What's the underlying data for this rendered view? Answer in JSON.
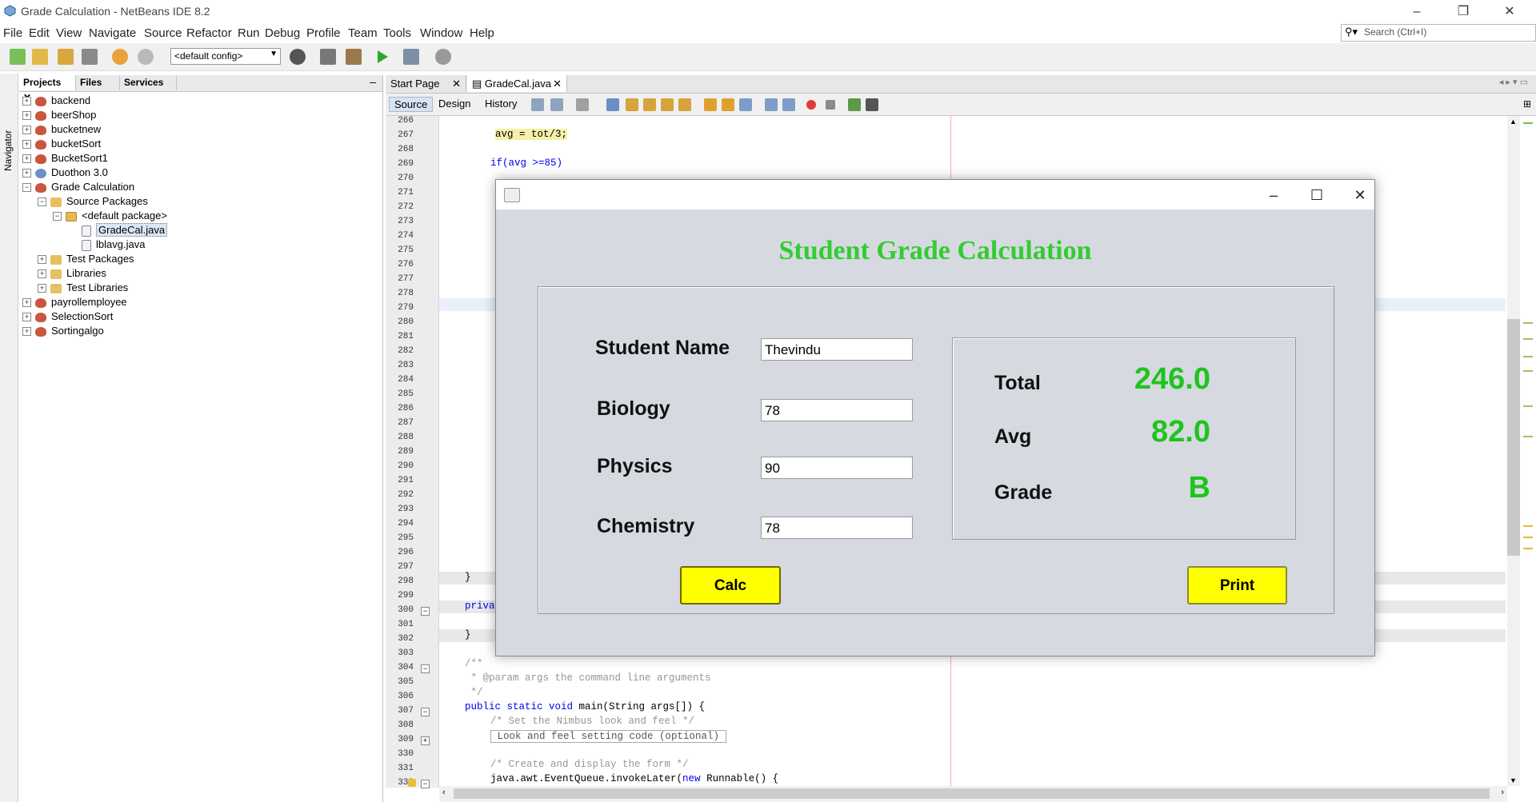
{
  "window": {
    "title": "Grade Calculation - NetBeans IDE 8.2",
    "search_placeholder": "Search (Ctrl+I)"
  },
  "menu": [
    "File",
    "Edit",
    "View",
    "Navigate",
    "Source",
    "Refactor",
    "Run",
    "Debug",
    "Profile",
    "Team",
    "Tools",
    "Window",
    "Help"
  ],
  "toolbar": {
    "config": "<default config>"
  },
  "sidebar": {
    "navigator_label": "Navigator",
    "tabs": [
      "Projects",
      "Files",
      "Services"
    ],
    "tree": [
      {
        "label": "backend",
        "icon": "coffee-icon",
        "expand": "+"
      },
      {
        "label": "beerShop",
        "icon": "coffee-icon",
        "expand": "+"
      },
      {
        "label": "bucketnew",
        "icon": "coffee-icon",
        "expand": "+"
      },
      {
        "label": "bucketSort",
        "icon": "coffee-icon",
        "expand": "+"
      },
      {
        "label": "BucketSort1",
        "icon": "coffee-icon",
        "expand": "+"
      },
      {
        "label": "Duothon 3.0",
        "icon": "globe-icon",
        "expand": "+"
      },
      {
        "label": "Grade Calculation",
        "icon": "coffee-icon",
        "expand": "−"
      },
      {
        "label": "Source Packages",
        "icon": "folder-icon",
        "expand": "−"
      },
      {
        "label": "<default package>",
        "icon": "package-icon",
        "expand": "−"
      },
      {
        "label": "GradeCal.java",
        "icon": "java-file-icon",
        "expand": ""
      },
      {
        "label": "lblavg.java",
        "icon": "java-file-icon",
        "expand": ""
      },
      {
        "label": "Test Packages",
        "icon": "folder-icon",
        "expand": "+"
      },
      {
        "label": "Libraries",
        "icon": "folder-icon",
        "expand": "+"
      },
      {
        "label": "Test Libraries",
        "icon": "folder-icon",
        "expand": "+"
      },
      {
        "label": "payrollemployee",
        "icon": "coffee-icon",
        "expand": "+"
      },
      {
        "label": "SelectionSort",
        "icon": "coffee-icon",
        "expand": "+"
      },
      {
        "label": "Sortingalgo",
        "icon": "coffee-icon",
        "expand": "+"
      }
    ]
  },
  "editor": {
    "tabs": [
      "Start Page",
      "GradeCal.java"
    ],
    "subtabs": [
      "Source",
      "Design",
      "History"
    ],
    "line_numbers": [
      "266",
      "267",
      "268",
      "269",
      "270",
      "271",
      "272",
      "273",
      "274",
      "275",
      "276",
      "277",
      "278",
      "279",
      "280",
      "281",
      "282",
      "283",
      "284",
      "285",
      "286",
      "287",
      "288",
      "289",
      "290",
      "291",
      "292",
      "293",
      "294",
      "295",
      "296",
      "297",
      "298",
      "299",
      "300",
      "301",
      "302",
      "303",
      "304",
      "305",
      "306",
      "307",
      "308",
      "309",
      "330",
      "331",
      "332"
    ],
    "code": {
      "l267": "avg = tot/3;",
      "l269": "if(avg >=85)",
      "l298": "}",
      "l300": "priva",
      "l302": "}",
      "l304": "/**",
      "l305": " * @param args the command line arguments",
      "l306": " */",
      "l307a": "public static void",
      "l307b": " main(String args[]) {",
      "l308": "/* Set the Nimbus look and feel */",
      "l309": " Look and feel setting code (optional) ",
      "l331": "/* Create and display the form */",
      "l332a": "java.awt.EventQueue.invokeLater(",
      "l332b": "new",
      "l332c": " Runnable() {"
    }
  },
  "dialog": {
    "heading": "Student Grade Calculation",
    "fields": {
      "name_label": "Student Name",
      "name_value": "Thevindu",
      "biology_label": "Biology",
      "biology_value": "78",
      "physics_label": "Physics",
      "physics_value": "90",
      "chemistry_label": "Chemistry",
      "chemistry_value": "78"
    },
    "results": {
      "total_label": "Total",
      "total_value": "246.0",
      "avg_label": "Avg",
      "avg_value": "82.0",
      "grade_label": "Grade",
      "grade_value": "B"
    },
    "calc_button": "Calc",
    "print_button": "Print"
  },
  "colors": {
    "heading_green": "#33cc33",
    "result_green": "#1ec41e",
    "button_yellow": "#ffff00",
    "dialog_bg": "#d6d9df"
  }
}
